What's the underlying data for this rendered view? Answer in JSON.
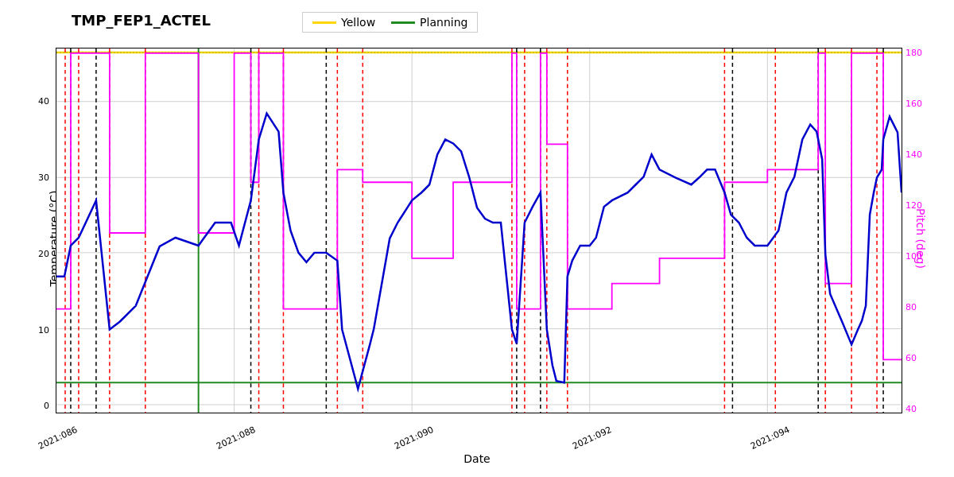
{
  "chart": {
    "title": "TMP_FEP1_ACTEL",
    "x_axis_label": "Date",
    "y_left_label": "Temperature (°C)",
    "y_right_label": "Pitch (deg)",
    "legend": {
      "items": [
        {
          "label": "Yellow",
          "color": "#FFD700",
          "type": "line"
        },
        {
          "label": "Planning",
          "color": "#228B22",
          "type": "line"
        }
      ]
    },
    "x_ticks": [
      "2021:086",
      "2021:088",
      "2021:090",
      "2021:092",
      "2021:094"
    ],
    "y_left_ticks": [
      "0",
      "10",
      "20",
      "30",
      "40"
    ],
    "y_right_ticks": [
      "40",
      "60",
      "80",
      "100",
      "120",
      "140",
      "160",
      "180"
    ],
    "y_left_min": -1,
    "y_left_max": 47,
    "y_right_min": 38,
    "y_right_max": 182,
    "colors": {
      "yellow_limit": "#FFD700",
      "planning": "#228B22",
      "temperature": "#0000CC",
      "pitch": "#FF00FF",
      "red_dotted": "#FF0000",
      "black_dotted": "#000000",
      "grid": "#d0d0d0"
    }
  }
}
